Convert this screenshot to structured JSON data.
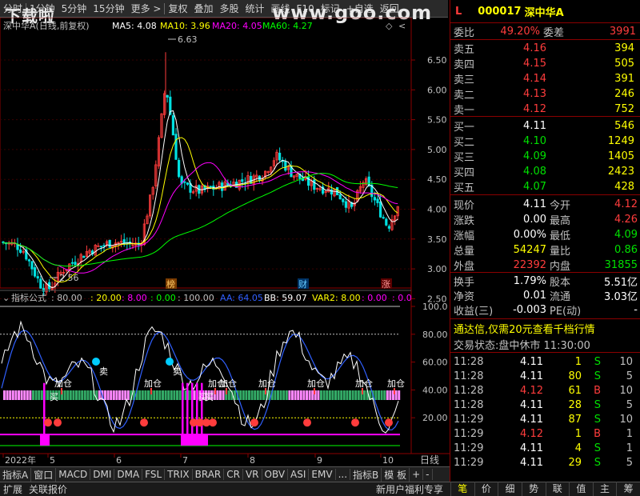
{
  "toolbar": {
    "left_items": [
      "分时",
      "1分钟",
      "5分钟",
      "15分钟",
      "更多 >"
    ],
    "right_items": [
      "复权",
      "叠加",
      "多股",
      "统计",
      "画线",
      "F10",
      "标记",
      "+自选",
      "返回"
    ]
  },
  "watermark": "www.goo.com",
  "logo_wm": "下载啦",
  "main_legend": {
    "title": "深中华A(日线,前复权)",
    "ma5": "MA5: 4.08",
    "ma10": "MA10: 3.96",
    "ma20": "MA20: 4.05",
    "ma60": "MA60: 4.27"
  },
  "price_axis": [
    "6.50",
    "6.00",
    "5.50",
    "5.00",
    "4.50",
    "4.00",
    "3.50",
    "3.00",
    "2.50"
  ],
  "price_annotations": {
    "high": "6.63",
    "low": "2.56"
  },
  "event_badges": [
    "榜",
    "财",
    "涨"
  ],
  "indicator_legend": {
    "title": "指标公式",
    "v1": ": 80.00",
    "v2": ": 20.00",
    "v3": ": 8.00",
    "v4": ": 0.00",
    "v5": ": 100.00",
    "aa": "AA: 64.05",
    "bb": "BB: 59.07",
    "var2": "VAR2: 8.00",
    "v6": ": 0.00",
    "v7": ": 0.0"
  },
  "indicator_axis": [
    "100.0",
    "80.00",
    "60.00",
    "40.00",
    "20.00"
  ],
  "signal_labels": {
    "add": "加仓",
    "sell": "卖",
    "buy": "买"
  },
  "date_axis": [
    "2022年",
    "5",
    "6",
    "7",
    "8",
    "9",
    "10"
  ],
  "period_label": "日线",
  "indicator_tabs": [
    "指标A",
    "窗口",
    "MACD",
    "DMI",
    "DMA",
    "FSL",
    "TRIX",
    "BRAR",
    "CR",
    "VR",
    "OBV",
    "ASI",
    "EMV",
    "...",
    "指标B",
    "模 板",
    "+",
    "-"
  ],
  "footer": {
    "left": [
      "扩展",
      "关联报价"
    ],
    "right": "新用户福利专享"
  },
  "right_tabs": [
    "笔",
    "价",
    "细",
    "势",
    "联",
    "值",
    "主",
    "筹"
  ],
  "quote": {
    "marker": "L",
    "code": "000017",
    "name": "深中华A",
    "weibi_label": "委比",
    "weibi": "49.20%",
    "weicha_label": "委差",
    "weicha": "3991",
    "asks": [
      {
        "label": "卖五",
        "price": "4.16",
        "vol": "394"
      },
      {
        "label": "卖四",
        "price": "4.15",
        "vol": "505"
      },
      {
        "label": "卖三",
        "price": "4.14",
        "vol": "391"
      },
      {
        "label": "卖二",
        "price": "4.13",
        "vol": "246"
      },
      {
        "label": "卖一",
        "price": "4.12",
        "vol": "752"
      }
    ],
    "bids": [
      {
        "label": "买一",
        "price": "4.11",
        "vol": "546"
      },
      {
        "label": "买二",
        "price": "4.10",
        "vol": "1249"
      },
      {
        "label": "买三",
        "price": "4.09",
        "vol": "1405"
      },
      {
        "label": "买四",
        "price": "4.08",
        "vol": "2423"
      },
      {
        "label": "买五",
        "price": "4.07",
        "vol": "428"
      }
    ],
    "stats": [
      {
        "l1": "现价",
        "v1": "4.11",
        "c1": "white",
        "l2": "今开",
        "v2": "4.12",
        "c2": "red"
      },
      {
        "l1": "涨跌",
        "v1": "0.00",
        "c1": "white",
        "l2": "最高",
        "v2": "4.26",
        "c2": "red"
      },
      {
        "l1": "涨幅",
        "v1": "0.00%",
        "c1": "white",
        "l2": "最低",
        "v2": "4.09",
        "c2": "green"
      },
      {
        "l1": "总量",
        "v1": "54247",
        "c1": "yellow",
        "l2": "量比",
        "v2": "0.86",
        "c2": "green"
      },
      {
        "l1": "外盘",
        "v1": "22392",
        "c1": "red",
        "l2": "内盘",
        "v2": "31855",
        "c2": "green"
      }
    ],
    "stats2": [
      {
        "l1": "换手",
        "v1": "1.79%",
        "l2": "股本",
        "v2": "5.51亿"
      },
      {
        "l1": "净资",
        "v1": "0.01",
        "l2": "流通",
        "v2": "3.03亿"
      },
      {
        "l1": "收益(三)",
        "v1": "-0.003",
        "l2": "PE(动)",
        "v2": "-"
      }
    ],
    "promo": "通达信,仅需20元查看千档行情",
    "trade_status_label": "交易状态:",
    "trade_status": "盘中休市 11:30:00"
  },
  "ticks": [
    {
      "time": "11:28",
      "price": "4.11",
      "pc": "white",
      "vol": "1",
      "side": "S"
    },
    {
      "time": "11:28",
      "price": "4.11",
      "pc": "white",
      "vol": "80",
      "side": "S"
    },
    {
      "time": "11:28",
      "price": "4.12",
      "pc": "red",
      "vol": "61",
      "side": "B"
    },
    {
      "time": "11:28",
      "price": "4.11",
      "pc": "white",
      "vol": "28",
      "side": "S"
    },
    {
      "time": "11:29",
      "price": "4.11",
      "pc": "white",
      "vol": "87",
      "side": "S"
    },
    {
      "time": "11:29",
      "price": "4.12",
      "pc": "red",
      "vol": "1",
      "side": "B"
    },
    {
      "time": "11:29",
      "price": "4.11",
      "pc": "white",
      "vol": "4",
      "side": "S"
    },
    {
      "time": "11:29",
      "price": "4.11",
      "pc": "white",
      "vol": "29",
      "side": "S"
    }
  ],
  "tick_extra": [
    "10",
    "5",
    "10",
    "5",
    "10",
    "1",
    "1",
    "5"
  ],
  "colors": {
    "up": "#ff3c3c",
    "down": "#00e000",
    "ma5": "#ffffff",
    "ma10": "#ffff00",
    "ma20": "#ff00ff",
    "ma60": "#00ff00",
    "grid": "#8b0000"
  }
}
